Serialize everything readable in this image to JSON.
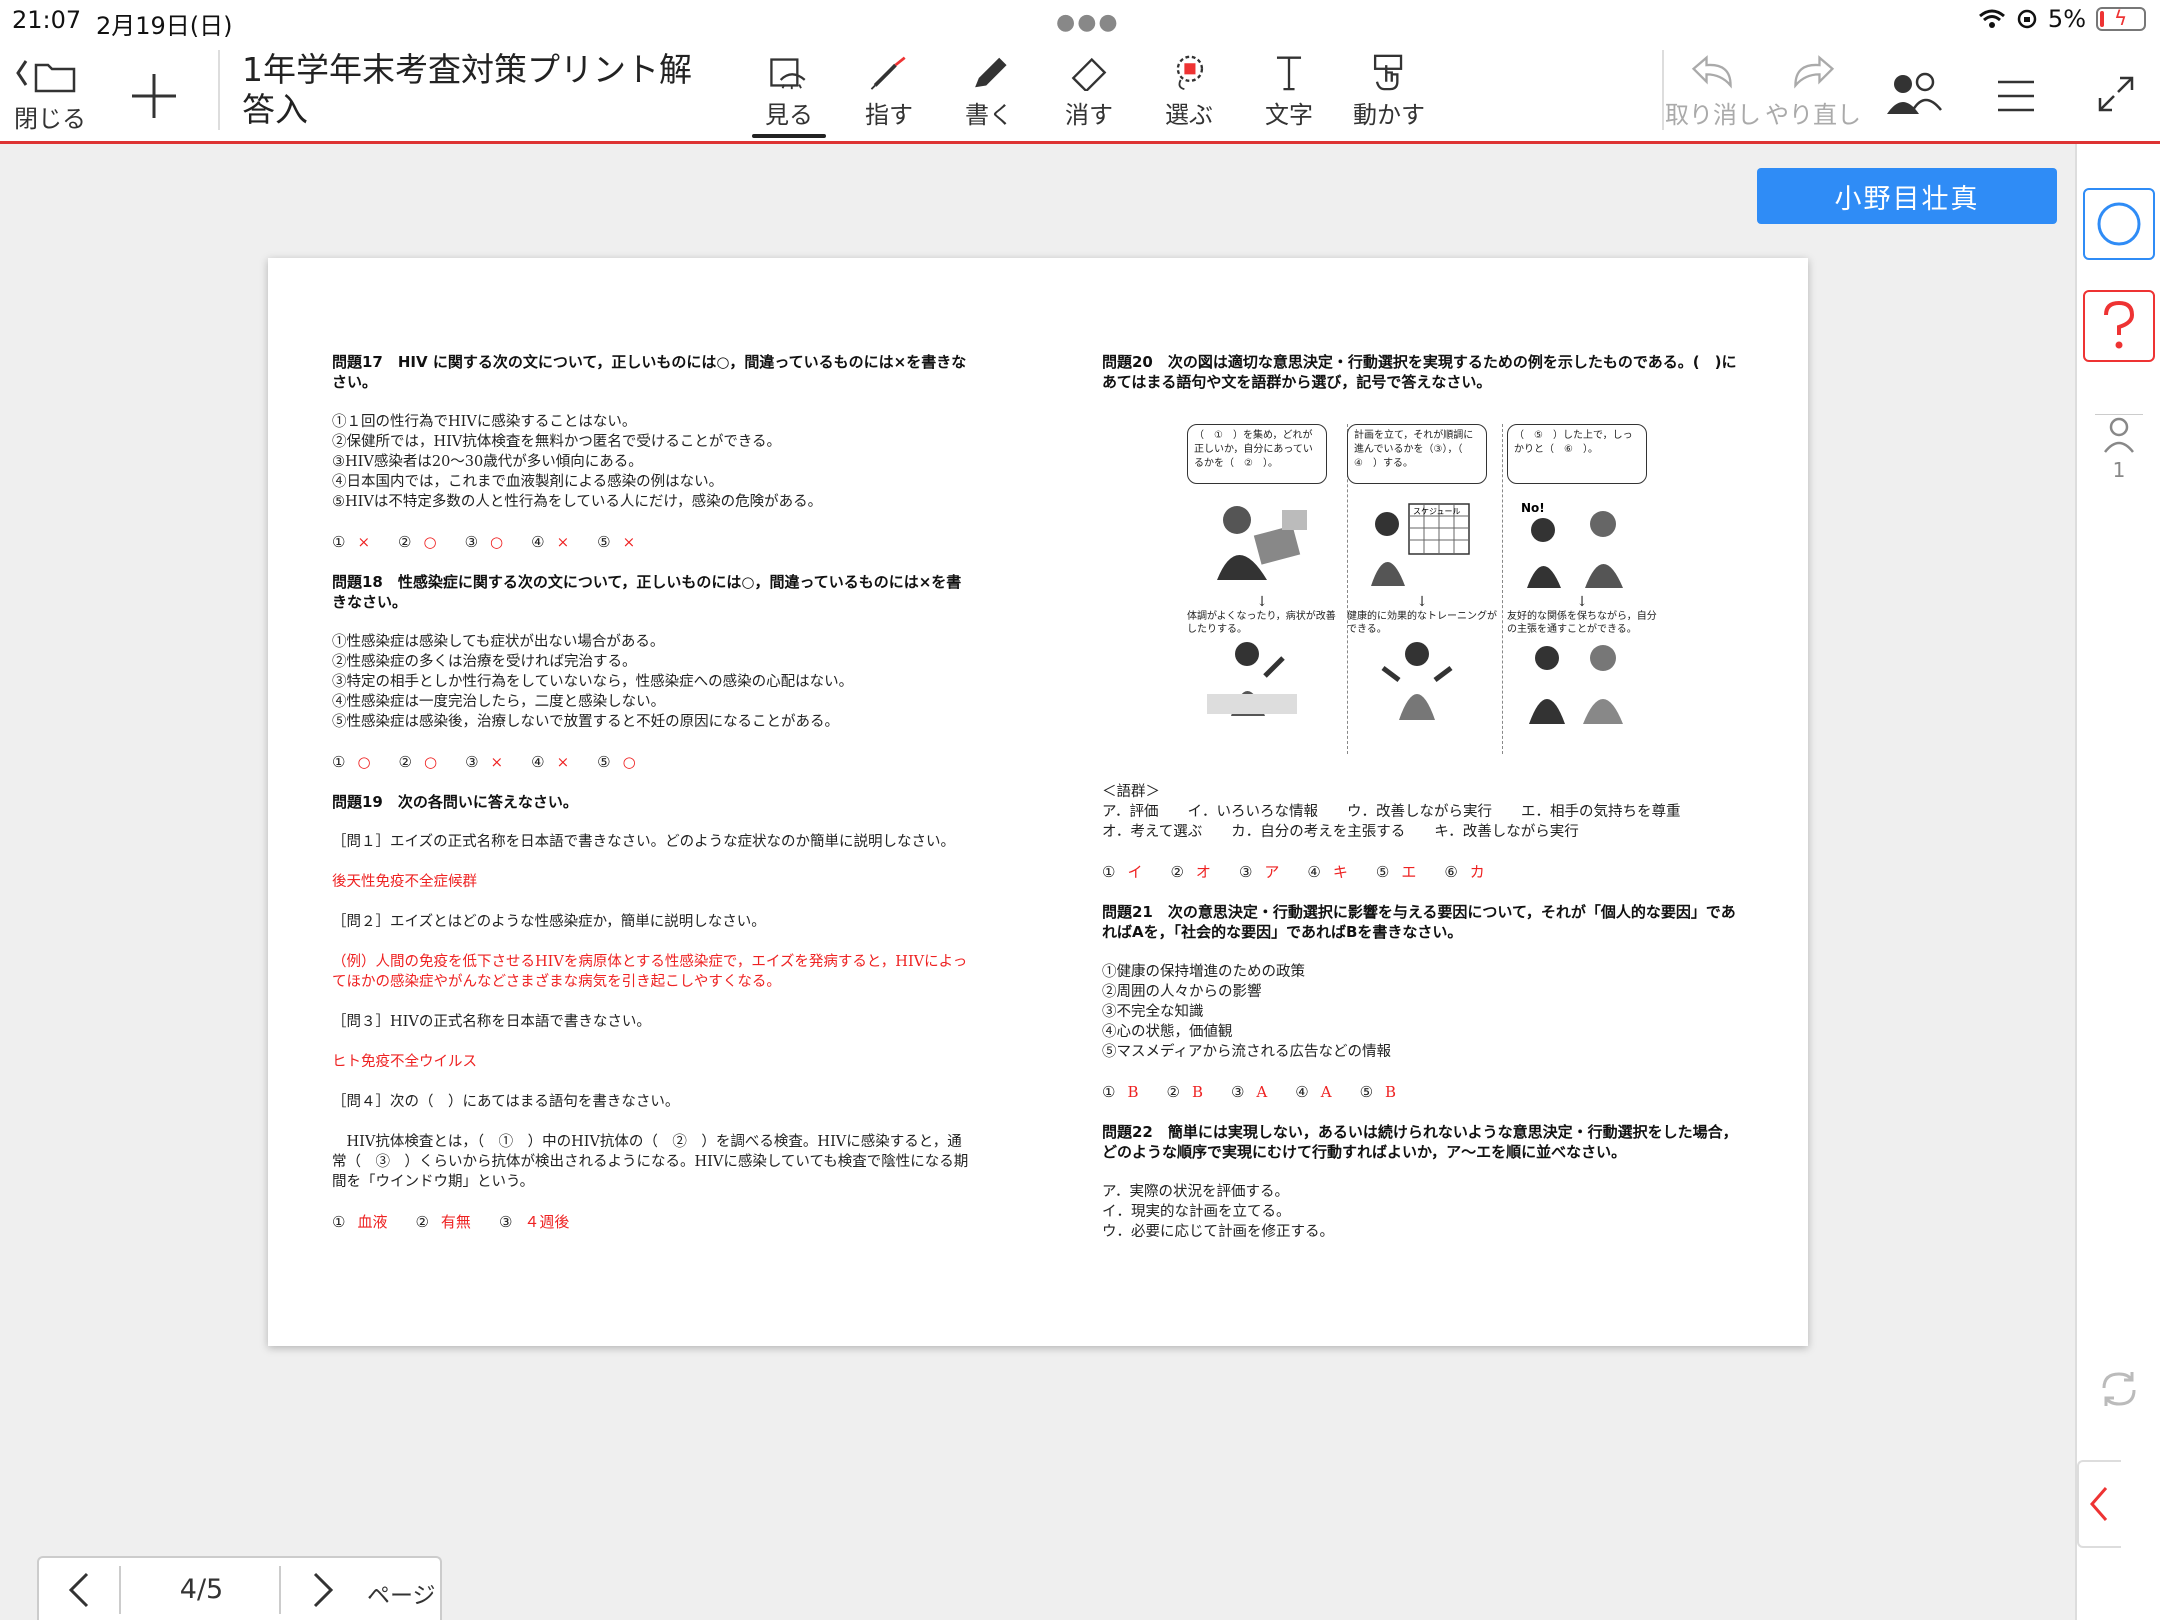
{
  "status": {
    "time": "21:07",
    "date": "2月19日(日)",
    "battery": "5%"
  },
  "toolbar": {
    "close_label": "閉じる",
    "doc_title": "1年学年末考査対策プリント解答入",
    "tools": [
      {
        "label": "見る",
        "icon": "view-icon"
      },
      {
        "label": "指す",
        "icon": "laser-pointer-icon"
      },
      {
        "label": "書く",
        "icon": "pen-icon"
      },
      {
        "label": "消す",
        "icon": "eraser-icon"
      },
      {
        "label": "選ぶ",
        "icon": "lasso-select-icon"
      },
      {
        "label": "文字",
        "icon": "text-icon"
      },
      {
        "label": "動かす",
        "icon": "move-hand-icon"
      }
    ],
    "undo_label": "取り消し",
    "redo_label": "やり直し"
  },
  "user_button": "小野目壮真",
  "right_panel": {
    "participant_count": "1"
  },
  "pager": {
    "current": "4/5",
    "label": "ページ"
  },
  "document": {
    "left": {
      "q17": {
        "title": "問題17　HIV に関する次の文について，正しいものには○，間違っているものには×を書きなさい。",
        "items": [
          "①１回の性行為でHIVに感染することはない。",
          "②保健所では，HIV抗体検査を無料かつ匿名で受けることができる。",
          "③HIV感染者は20～30歳代が多い傾向にある。",
          "④日本国内では，これまで血液製剤による感染の例はない。",
          "⑤HIVは不特定多数の人と性行為をしている人にだけ，感染の危険がある。"
        ],
        "answers": [
          {
            "n": "①",
            "v": "×"
          },
          {
            "n": "②",
            "v": "○"
          },
          {
            "n": "③",
            "v": "○"
          },
          {
            "n": "④",
            "v": "×"
          },
          {
            "n": "⑤",
            "v": "×"
          }
        ]
      },
      "q18": {
        "title": "問題18　性感染症に関する次の文について，正しいものには○，間違っているものには×を書きなさい。",
        "items": [
          "①性感染症は感染しても症状が出ない場合がある。",
          "②性感染症の多くは治療を受ければ完治する。",
          "③特定の相手としか性行為をしていないなら，性感染症への感染の心配はない。",
          "④性感染症は一度完治したら，二度と感染しない。",
          "⑤性感染症は感染後，治療しないで放置すると不妊の原因になることがある。"
        ],
        "answers": [
          {
            "n": "①",
            "v": "○"
          },
          {
            "n": "②",
            "v": "○"
          },
          {
            "n": "③",
            "v": "×"
          },
          {
            "n": "④",
            "v": "×"
          },
          {
            "n": "⑤",
            "v": "○"
          }
        ]
      },
      "q19": {
        "title": "問題19　次の各問いに答えなさい。",
        "s1": "［問１］エイズの正式名称を日本語で書きなさい。どのような症状なのか簡単に説明しなさい。",
        "a1": "後天性免疫不全症候群",
        "s2": "［問２］エイズとはどのような性感染症か，簡単に説明しなさい。",
        "a2": "（例）人間の免疫を低下させるHIVを病原体とする性感染症で，エイズを発病すると，HIVによってほかの感染症やがんなどさまざまな病気を引き起こしやすくなる。",
        "s3": "［問３］HIVの正式名称を日本語で書きなさい。",
        "a3": "ヒト免疫不全ウイルス",
        "s4": "［問４］次の（　）にあてはまる語句を書きなさい。",
        "s4text": "　HIV抗体検査とは，（　①　）中のHIV抗体の（　②　）を調べる検査。HIVに感染すると，通常（　③　）くらいから抗体が検出されるようになる。HIVに感染していても検査で陰性になる期間を「ウインドウ期」という。",
        "answers": [
          {
            "n": "①",
            "v": "血液"
          },
          {
            "n": "②",
            "v": "有無"
          },
          {
            "n": "③",
            "v": "４週後"
          }
        ]
      }
    },
    "right": {
      "q20": {
        "title": "問題20　次の図は適切な意思決定・行動選択を実現するための例を示したものである。(　)にあてはまる語句や文を語群から選び，記号で答えなさい。",
        "bubbles": [
          "（　①　）を集め，どれが正しいか，自分にあっているかを（　②　）。",
          "計画を立て，それが順調に進んでいるかを（③），（　④　）する。",
          "（　⑤　）した上で，しっかりと（　⑥　）。"
        ],
        "captions": [
          "体調がよくなったり，病状が改善したりする。",
          "健康的に効果的なトレーニングができる。",
          "友好的な関係を保ちながら，自分の主張を通すことができる。"
        ],
        "schedule": "スケジュール",
        "no_bubble": "No!",
        "bank_title": "＜語群＞",
        "bank1": "ア．評価　　イ．いろいろな情報　　ウ．改善しながら実行　　エ．相手の気持ちを尊重",
        "bank2": "オ．考えて選ぶ　　カ．自分の考えを主張する　　キ．改善しながら実行",
        "answers": [
          {
            "n": "①",
            "v": "イ"
          },
          {
            "n": "②",
            "v": "オ"
          },
          {
            "n": "③",
            "v": "ア"
          },
          {
            "n": "④",
            "v": "キ"
          },
          {
            "n": "⑤",
            "v": "エ"
          },
          {
            "n": "⑥",
            "v": "カ"
          }
        ]
      },
      "q21": {
        "title": "問題21　次の意思決定・行動選択に影響を与える要因について，それが「個人的な要因」であればAを，「社会的な要因」であればBを書きなさい。",
        "items": [
          "①健康の保持増進のための政策",
          "②周囲の人々からの影響",
          "③不完全な知識",
          "④心の状態，価値観",
          "⑤マスメディアから流される広告などの情報"
        ],
        "answers": [
          {
            "n": "①",
            "v": "B"
          },
          {
            "n": "②",
            "v": "B"
          },
          {
            "n": "③",
            "v": "A"
          },
          {
            "n": "④",
            "v": "A"
          },
          {
            "n": "⑤",
            "v": "B"
          }
        ]
      },
      "q22": {
        "title": "問題22　簡単には実現しない，あるいは続けられないような意思決定・行動選択をした場合，どのような順序で実現にむけて行動すればよいか，ア～エを順に並べなさい。",
        "items": [
          "ア．実際の状況を評価する。",
          "イ．現実的な計画を立てる。",
          "ウ．必要に応じて計画を修正する。"
        ]
      }
    }
  }
}
